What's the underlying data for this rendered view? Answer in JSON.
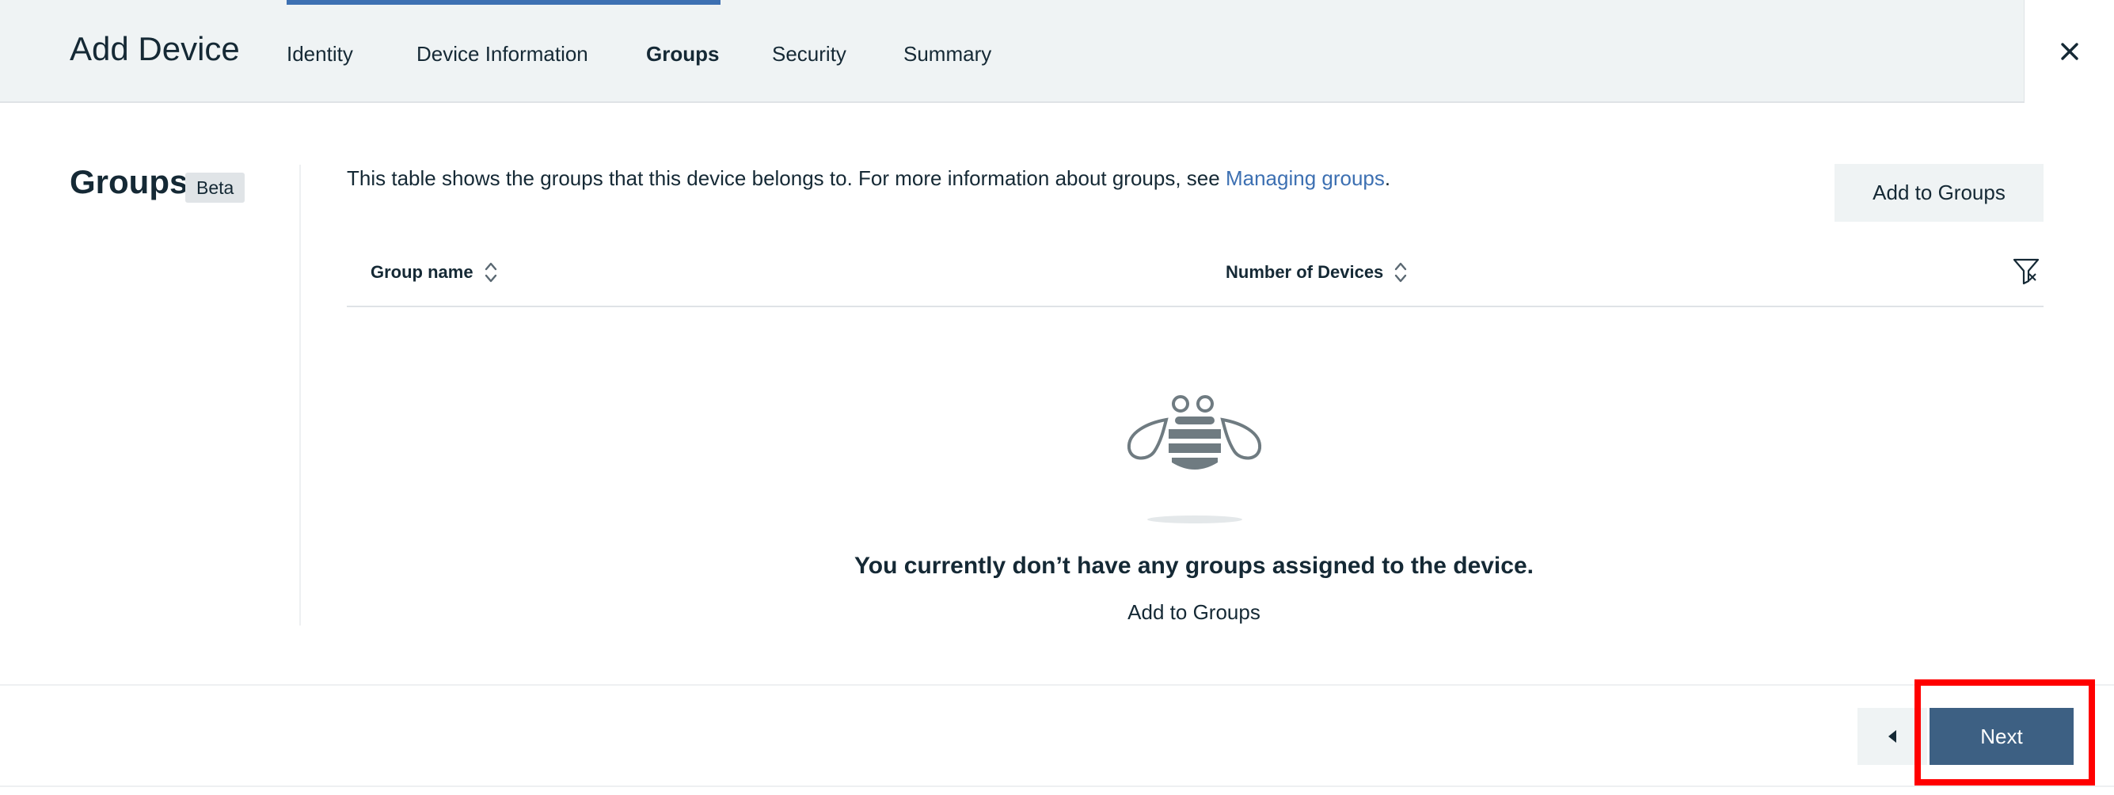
{
  "header": {
    "title": "Add Device",
    "tabs": [
      {
        "label": "Identity",
        "active": false
      },
      {
        "label": "Device Information",
        "active": false
      },
      {
        "label": "Groups",
        "active": true
      },
      {
        "label": "Security",
        "active": false
      },
      {
        "label": "Summary",
        "active": false
      }
    ],
    "close_icon": "close-icon"
  },
  "section": {
    "title": "Groups",
    "badge": "Beta"
  },
  "main": {
    "description_text": "This table shows the groups that this device belongs to. For more information about groups, see ",
    "description_link": "Managing groups",
    "description_end": ".",
    "add_button_label": "Add to Groups",
    "table": {
      "columns": [
        "Group name",
        "Number of Devices"
      ],
      "filter_icon": "filter-icon",
      "sort_icon": "sort-icon"
    },
    "empty_state": {
      "illustration": "bee-icon",
      "title": "You currently don’t have any groups assigned to the device.",
      "link": "Add to Groups"
    }
  },
  "footer": {
    "back_icon": "caret-left-icon",
    "next_label": "Next"
  },
  "colors": {
    "accent": "#3d70b2",
    "primary_button": "#3d6083",
    "highlight": "#ff0000",
    "header_bg": "#eff3f4"
  }
}
